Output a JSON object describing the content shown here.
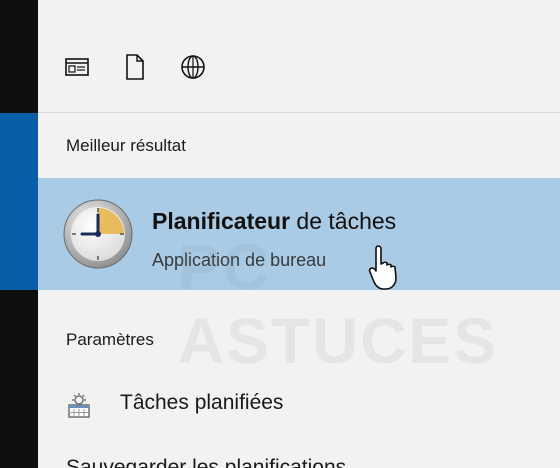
{
  "toolbar": {
    "icons": [
      "app-window-icon",
      "document-icon",
      "globe-icon"
    ]
  },
  "best_match": {
    "heading": "Meilleur résultat",
    "title_bold": "Planificateur",
    "title_rest": " de tâches",
    "subtitle": "Application de bureau"
  },
  "settings": {
    "heading": "Paramètres",
    "items": [
      {
        "label": "Tâches planifiées"
      }
    ],
    "partial_item": "Sauvegarder les planifications"
  },
  "watermark": "PC ASTUCES",
  "colors": {
    "highlight": "#a9cbe6",
    "accent": "#0a5ea7",
    "background": "#f2f2f2",
    "sidebar": "#0f0f0f"
  }
}
